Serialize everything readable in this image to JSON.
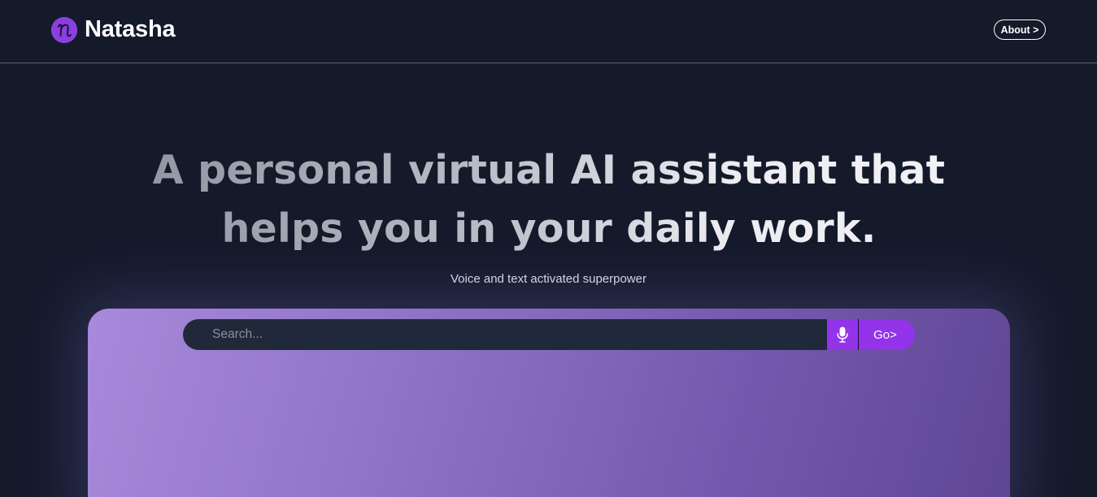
{
  "header": {
    "brand": "Natasha",
    "logo_icon": "cursive-n-logo-icon",
    "about_label": "About >"
  },
  "hero": {
    "title_line1": "A personal virtual AI assistant that",
    "title_line2": "helps you in your daily work.",
    "subtitle": "Voice and text activated superpower"
  },
  "search": {
    "placeholder": "Search...",
    "value": "",
    "mic_icon": "microphone-icon",
    "go_label": "Go>"
  },
  "colors": {
    "background": "#141a2a",
    "accent": "#9333ea",
    "logo": "#8b3fe0",
    "card_gradient_start": "#a889db",
    "card_gradient_end": "#5f4694",
    "search_field": "#202939"
  }
}
